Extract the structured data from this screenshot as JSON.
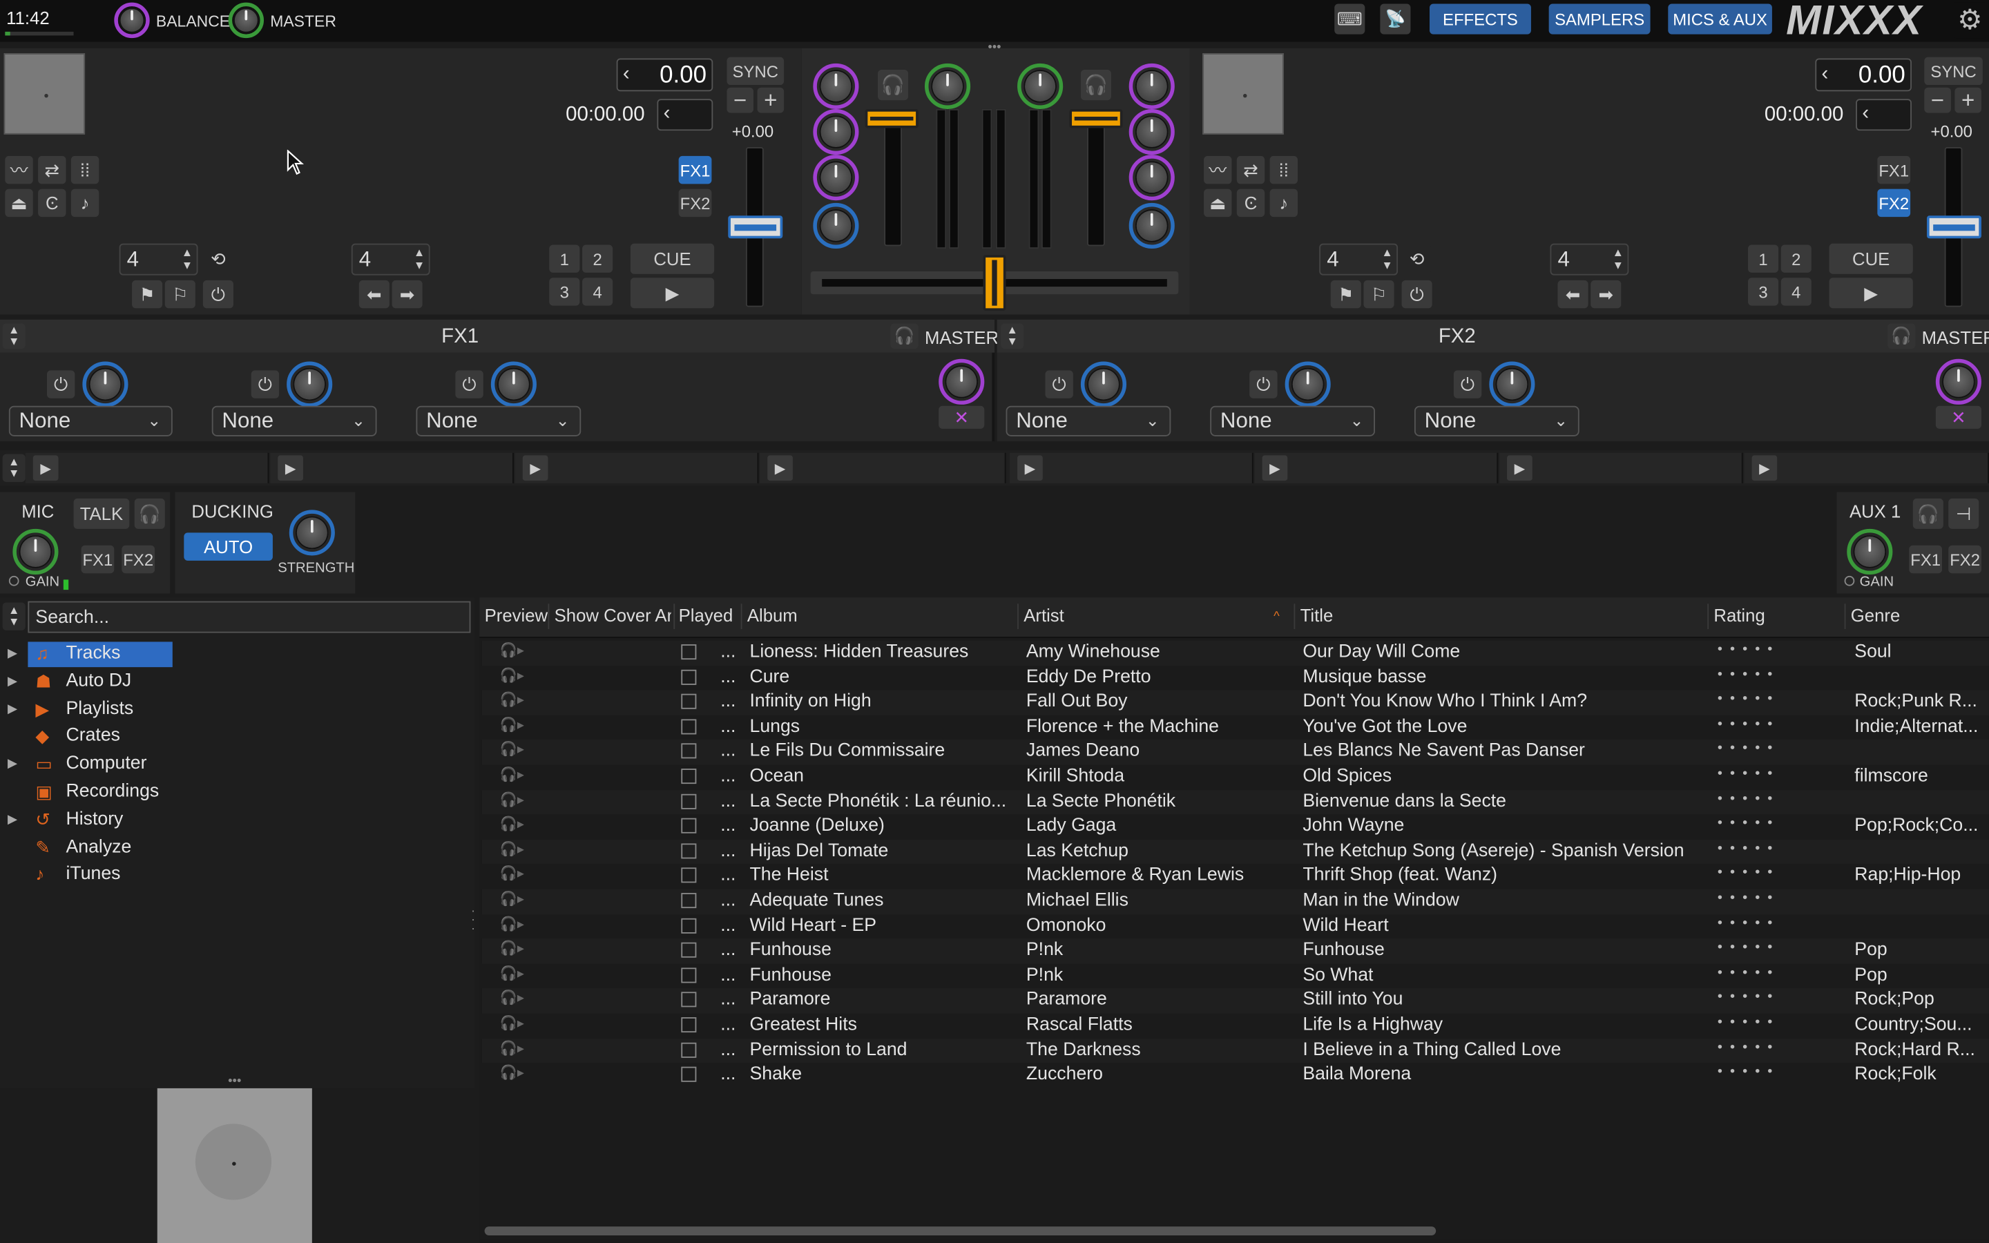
{
  "topbar": {
    "clock": "11:42",
    "balance_label": "BALANCE",
    "master_label": "MASTER",
    "effects_label": "EFFECTS",
    "samplers_label": "SAMPLERS",
    "mics_aux_label": "MICS & AUX",
    "logo": "MIXXX"
  },
  "deck1": {
    "rate": "0.00",
    "time": "00:00.00",
    "sync_label": "SYNC",
    "pitch": "+0.00",
    "fx1": "FX1",
    "fx2": "FX2",
    "beatloop": "4",
    "beatjump": "4",
    "cue_label": "CUE",
    "hotcues": [
      "1",
      "2",
      "3",
      "4"
    ]
  },
  "deck2": {
    "rate": "0.00",
    "time": "00:00.00",
    "sync_label": "SYNC",
    "pitch": "+0.00",
    "fx1": "FX1",
    "fx2": "FX2",
    "beatloop": "4",
    "beatjump": "4",
    "cue_label": "CUE",
    "hotcues": [
      "1",
      "2",
      "3",
      "4"
    ]
  },
  "fx_units": [
    {
      "title": "FX1",
      "master_label": "MASTER",
      "effects": [
        "None",
        "None",
        "None"
      ]
    },
    {
      "title": "FX2",
      "master_label": "MASTER",
      "effects": [
        "None",
        "None",
        "None"
      ]
    }
  ],
  "mic": {
    "label": "MIC",
    "talk_label": "TALK",
    "gain_label": "GAIN",
    "fx1": "FX1",
    "fx2": "FX2",
    "ducking_label": "DUCKING",
    "auto_label": "AUTO",
    "strength_label": "STRENGTH"
  },
  "aux": {
    "label": "AUX 1",
    "gain_label": "GAIN",
    "fx1": "FX1",
    "fx2": "FX2"
  },
  "library": {
    "search_placeholder": "Search...",
    "sidebar": [
      {
        "label": "Tracks",
        "icon": "tracks-icon",
        "expandable": true,
        "selected": true
      },
      {
        "label": "Auto DJ",
        "icon": "autodj-icon",
        "expandable": true
      },
      {
        "label": "Playlists",
        "icon": "playlists-icon",
        "expandable": true
      },
      {
        "label": "Crates",
        "icon": "crates-icon",
        "expandable": false
      },
      {
        "label": "Computer",
        "icon": "computer-icon",
        "expandable": true
      },
      {
        "label": "Recordings",
        "icon": "recordings-icon",
        "expandable": false
      },
      {
        "label": "History",
        "icon": "history-icon",
        "expandable": true
      },
      {
        "label": "Analyze",
        "icon": "analyze-icon",
        "expandable": false
      },
      {
        "label": "iTunes",
        "icon": "itunes-icon",
        "expandable": false
      }
    ],
    "columns": [
      "Preview",
      "Show Cover Art",
      "Played",
      "Album",
      "Artist",
      "Title",
      "Rating",
      "Genre"
    ],
    "more": "...",
    "tracks": [
      {
        "album": "Lioness: Hidden Treasures",
        "artist": "Amy Winehouse",
        "title": "Our Day Will Come",
        "genre": "Soul"
      },
      {
        "album": "Cure",
        "artist": "Eddy De Pretto",
        "title": "Musique basse",
        "genre": ""
      },
      {
        "album": "Infinity on High",
        "artist": "Fall Out Boy",
        "title": "Don't You Know Who I Think I Am?",
        "genre": "Rock;Punk R..."
      },
      {
        "album": "Lungs",
        "artist": "Florence + the Machine",
        "title": "You've Got the Love",
        "genre": "Indie;Alternat..."
      },
      {
        "album": "Le Fils Du Commissaire",
        "artist": "James Deano",
        "title": "Les Blancs Ne Savent Pas Danser",
        "genre": ""
      },
      {
        "album": "Ocean",
        "artist": "Kirill Shtoda",
        "title": "Old Spices",
        "genre": "filmscore"
      },
      {
        "album": "La Secte Phonétik : La réunio...",
        "artist": "La Secte Phonétik",
        "title": "Bienvenue dans la Secte",
        "genre": ""
      },
      {
        "album": "Joanne (Deluxe)",
        "artist": "Lady Gaga",
        "title": "John Wayne",
        "genre": "Pop;Rock;Co..."
      },
      {
        "album": "Hijas Del Tomate",
        "artist": "Las Ketchup",
        "title": "The Ketchup Song (Asereje) - Spanish Version",
        "genre": ""
      },
      {
        "album": "The Heist",
        "artist": "Macklemore & Ryan Lewis",
        "title": "Thrift Shop (feat. Wanz)",
        "genre": "Rap;Hip-Hop"
      },
      {
        "album": "Adequate Tunes",
        "artist": "Michael Ellis",
        "title": "Man in the Window",
        "genre": ""
      },
      {
        "album": "Wild Heart - EP",
        "artist": "Omonoko",
        "title": "Wild Heart",
        "genre": ""
      },
      {
        "album": "Funhouse",
        "artist": "P!nk",
        "title": "Funhouse",
        "genre": "Pop"
      },
      {
        "album": "Funhouse",
        "artist": "P!nk",
        "title": "So What",
        "genre": "Pop"
      },
      {
        "album": "Paramore",
        "artist": "Paramore",
        "title": "Still into You",
        "genre": "Rock;Pop"
      },
      {
        "album": "Greatest Hits",
        "artist": "Rascal Flatts",
        "title": "Life Is a Highway",
        "genre": "Country;Sou..."
      },
      {
        "album": "Permission to Land",
        "artist": "The Darkness",
        "title": "I Believe in a Thing Called Love",
        "genre": "Rock;Hard R..."
      },
      {
        "album": "Shake",
        "artist": "Zucchero",
        "title": "Baila Morena",
        "genre": "Rock;Folk"
      }
    ]
  },
  "colors": {
    "accent_blue": "#2a6fbf",
    "orange": "#f0a000",
    "purple": "#a040d0",
    "green": "#3a9a3a",
    "selected_row": "#2e6bc2"
  }
}
